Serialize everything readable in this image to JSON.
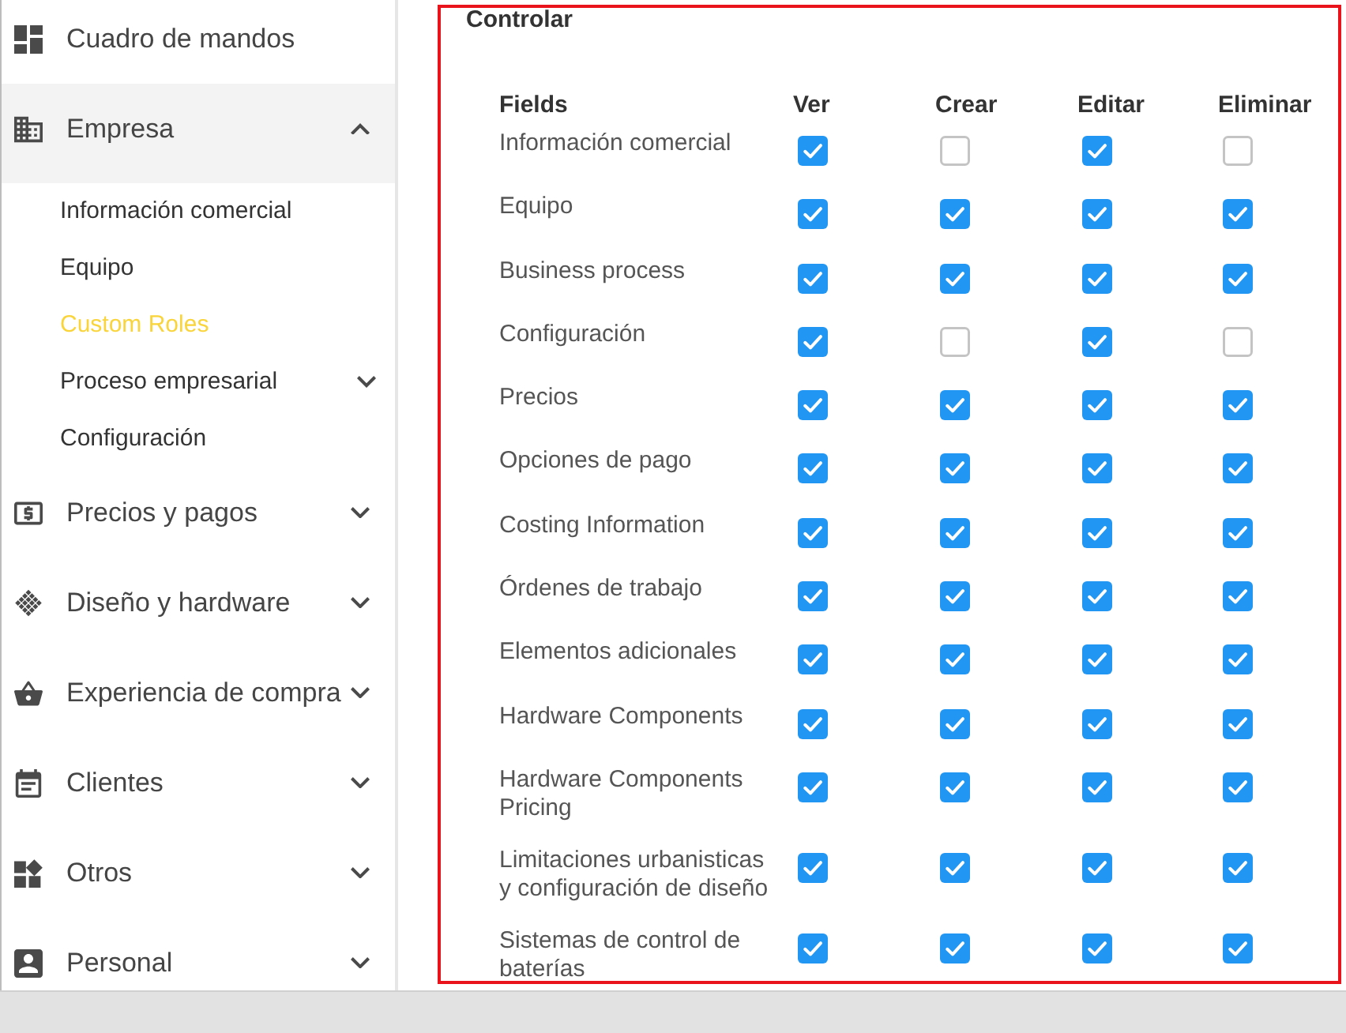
{
  "sidebar": {
    "items": [
      {
        "label": "Cuadro de mandos",
        "selected": false
      },
      {
        "label": "Empresa",
        "selected": true,
        "expanded": true,
        "children": [
          {
            "label": "Información comercial",
            "selected": false
          },
          {
            "label": "Equipo",
            "selected": false
          },
          {
            "label": "Custom Roles",
            "selected": true
          },
          {
            "label": "Proceso empresarial",
            "selected": false,
            "expanded": false
          },
          {
            "label": "Configuración",
            "selected": false
          }
        ]
      },
      {
        "label": "Precios y pagos",
        "selected": false,
        "expanded": false
      },
      {
        "label": "Diseño y hardware",
        "selected": false,
        "expanded": false
      },
      {
        "label": "Experiencia de compra",
        "selected": false,
        "expanded": false
      },
      {
        "label": "Clientes",
        "selected": false,
        "expanded": false
      },
      {
        "label": "Otros",
        "selected": false,
        "expanded": false
      },
      {
        "label": "Personal",
        "selected": false,
        "expanded": false
      }
    ]
  },
  "section": {
    "title": "Controlar",
    "table": {
      "columns": [
        "Fields",
        "Ver",
        "Crear",
        "Editar",
        "Eliminar"
      ],
      "rows": [
        {
          "label": "Información comercial",
          "permissions": [
            {
              "checked": true
            },
            {
              "checked": false
            },
            {
              "checked": true
            },
            {
              "checked": false
            }
          ]
        },
        {
          "label": "Equipo",
          "permissions": [
            {
              "checked": true
            },
            {
              "checked": true
            },
            {
              "checked": true
            },
            {
              "checked": true
            }
          ]
        },
        {
          "label": "Business process",
          "permissions": [
            {
              "checked": true
            },
            {
              "checked": true
            },
            {
              "checked": true
            },
            {
              "checked": true
            }
          ]
        },
        {
          "label": "Configuración",
          "permissions": [
            {
              "checked": true
            },
            {
              "checked": false
            },
            {
              "checked": true
            },
            {
              "checked": false
            }
          ]
        },
        {
          "label": "Precios",
          "permissions": [
            {
              "checked": true
            },
            {
              "checked": true
            },
            {
              "checked": true
            },
            {
              "checked": true
            }
          ]
        },
        {
          "label": "Opciones de pago",
          "permissions": [
            {
              "checked": true
            },
            {
              "checked": true
            },
            {
              "checked": true
            },
            {
              "checked": true
            }
          ]
        },
        {
          "label": "Costing Information",
          "permissions": [
            {
              "checked": true
            },
            {
              "checked": true
            },
            {
              "checked": true
            },
            {
              "checked": true
            }
          ]
        },
        {
          "label": "Órdenes de trabajo",
          "permissions": [
            {
              "checked": true
            },
            {
              "checked": true
            },
            {
              "checked": true
            },
            {
              "checked": true
            }
          ]
        },
        {
          "label": "Elementos adicionales",
          "permissions": [
            {
              "checked": true
            },
            {
              "checked": true
            },
            {
              "checked": true
            },
            {
              "checked": true
            }
          ]
        },
        {
          "label": "Hardware Components",
          "permissions": [
            {
              "checked": true
            },
            {
              "checked": true
            },
            {
              "checked": true
            },
            {
              "checked": true
            }
          ]
        },
        {
          "label": "Hardware Components Pricing",
          "permissions": [
            {
              "checked": true
            },
            {
              "checked": true
            },
            {
              "checked": true
            },
            {
              "checked": true
            }
          ]
        },
        {
          "label": "Limitaciones urbanisticas y configuración de diseño",
          "permissions": [
            {
              "checked": true
            },
            {
              "checked": true
            },
            {
              "checked": true
            },
            {
              "checked": true
            }
          ]
        },
        {
          "label": "Sistemas de control de baterías",
          "permissions": [
            {
              "checked": true
            },
            {
              "checked": true
            },
            {
              "checked": true
            },
            {
              "checked": true
            }
          ]
        }
      ]
    }
  }
}
